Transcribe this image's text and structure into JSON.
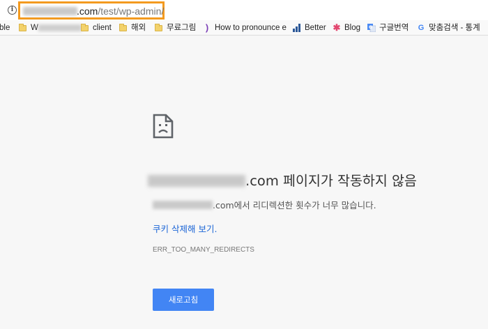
{
  "address_bar": {
    "url_visible": ".com/test/wp-admin/",
    "url_domain_suffix": ".com",
    "url_path": "/test/wp-admin/",
    "highlight_color": "#f39a1f",
    "icon": "info-icon"
  },
  "bookmarks": [
    {
      "label": "ble",
      "icon": "none"
    },
    {
      "label": "W",
      "icon": "folder-icon",
      "blurred": true
    },
    {
      "label": "client",
      "icon": "folder-icon"
    },
    {
      "label": "해외",
      "icon": "folder-icon"
    },
    {
      "label": "무료그림",
      "icon": "folder-icon"
    },
    {
      "label": "How to pronounce e",
      "icon": "pronounce-icon"
    },
    {
      "label": "Better",
      "icon": "bar-chart-icon"
    },
    {
      "label": "Blog",
      "icon": "flower-icon"
    },
    {
      "label": "구글번역",
      "icon": "translate-icon"
    },
    {
      "label": "맞춤검색 - 통계",
      "icon": "google-icon"
    }
  ],
  "error_page": {
    "icon": "sad-page-icon",
    "title_domain_suffix": ".com",
    "title_text": " 페이지가 작동하지 않음",
    "description_domain_suffix": ".com",
    "description_text": "에서 리디렉션한 횟수가 너무 많습니다.",
    "link_label": "쿠키 삭제해 보기.",
    "error_code": "ERR_TOO_MANY_REDIRECTS",
    "reload_button_label": "새로고침",
    "link_color": "#1a64d6",
    "button_color": "#4285f4"
  }
}
